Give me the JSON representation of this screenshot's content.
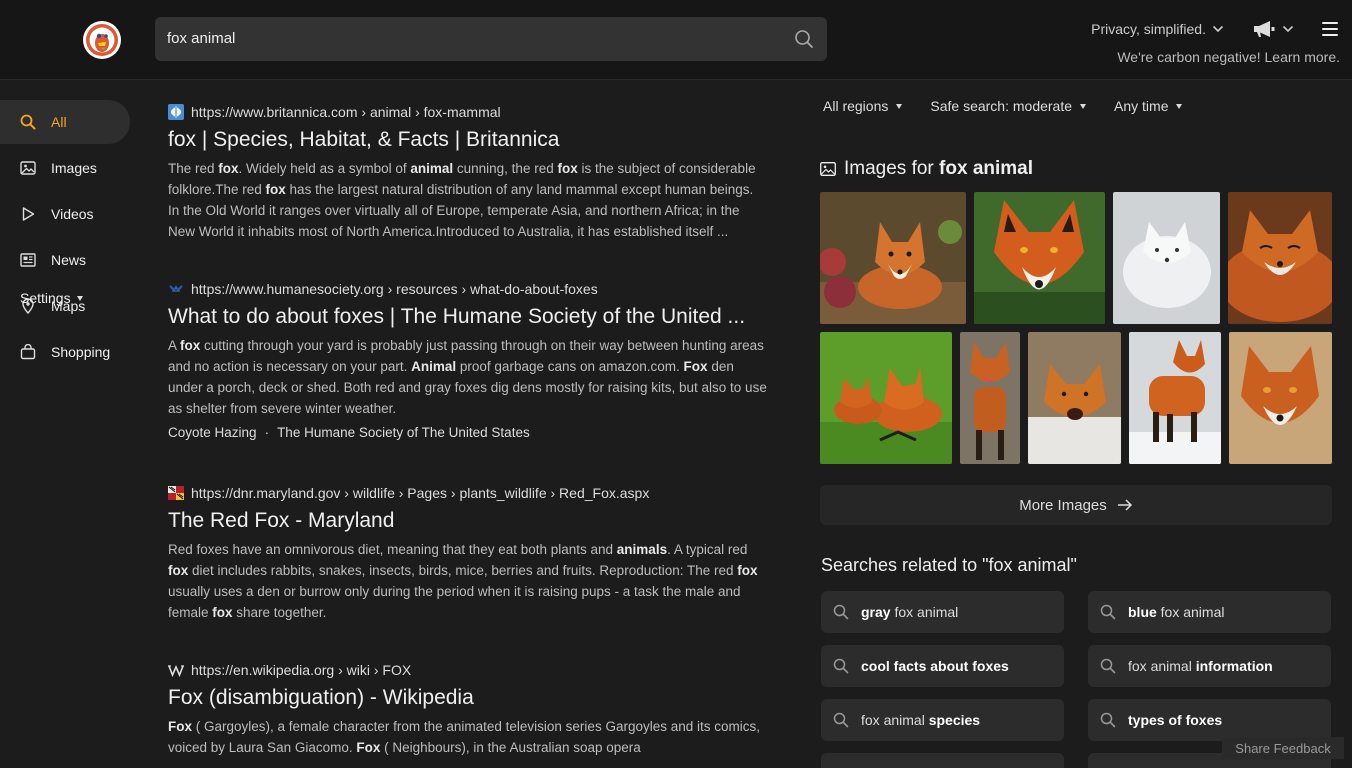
{
  "header": {
    "search_query": "fox animal",
    "privacy_label": "Privacy, simplified.",
    "carbon_text": "We're carbon negative! Learn more."
  },
  "sidebar": {
    "items": [
      {
        "label": "All",
        "icon": "search-icon"
      },
      {
        "label": "Images",
        "icon": "image-icon"
      },
      {
        "label": "Videos",
        "icon": "play-icon"
      },
      {
        "label": "News",
        "icon": "newspaper-icon"
      },
      {
        "label": "Maps",
        "icon": "map-pin-icon"
      },
      {
        "label": "Shopping",
        "icon": "shopping-bag-icon"
      }
    ],
    "settings_label": "Settings"
  },
  "results": [
    {
      "url": "https://www.britannica.com › animal › fox-mammal",
      "title": "fox | Species, Habitat, & Facts | Britannica",
      "snippet": [
        {
          "t": "The red "
        },
        {
          "b": "fox"
        },
        {
          "t": ". Widely held as a symbol of "
        },
        {
          "b": "animal"
        },
        {
          "t": " cunning, the red "
        },
        {
          "b": "fox"
        },
        {
          "t": " is the subject of considerable folklore.The red "
        },
        {
          "b": "fox"
        },
        {
          "t": " has the largest natural distribution of any land mammal except human beings. In the Old World it ranges over virtually all of Europe, temperate Asia, and northern Africa; in the New World it inhabits most of North America.Introduced to Australia, it has established itself ..."
        }
      ]
    },
    {
      "url": "https://www.humanesociety.org › resources › what-do-about-foxes",
      "title": "What to do about foxes | The Humane Society of the United ...",
      "snippet": [
        {
          "t": "A "
        },
        {
          "b": "fox"
        },
        {
          "t": " cutting through your yard is probably just passing through on their way between hunting areas and no action is necessary on your part. "
        },
        {
          "b": "Animal"
        },
        {
          "t": " proof garbage cans on amazon.com. "
        },
        {
          "b": "Fox"
        },
        {
          "t": " den under a porch, deck or shed. Both red and gray foxes dig dens mostly for raising kits, but also to use as shelter from severe winter weather."
        }
      ],
      "sitelinks": [
        "Coyote Hazing",
        "·",
        "The Humane Society of The United States"
      ]
    },
    {
      "url": "https://dnr.maryland.gov › wildlife › Pages › plants_wildlife › Red_Fox.aspx",
      "title": "The Red Fox - Maryland",
      "snippet": [
        {
          "t": "Red foxes have an omnivorous diet, meaning that they eat both plants and "
        },
        {
          "b": "animals"
        },
        {
          "t": ". A typical red "
        },
        {
          "b": "fox"
        },
        {
          "t": " diet includes rabbits, snakes, insects, birds, mice, berries and fruits. Reproduction: The red "
        },
        {
          "b": "fox"
        },
        {
          "t": " usually uses a den or burrow only during the period when it is raising pups - a task the male and female "
        },
        {
          "b": "fox"
        },
        {
          "t": " share together."
        }
      ]
    },
    {
      "url": "https://en.wikipedia.org › wiki › FOX",
      "title": "Fox (disambiguation) - Wikipedia",
      "snippet": [
        {
          "b": "Fox"
        },
        {
          "t": " ( Gargoyles), a female character from the animated television series Gargoyles and its comics, voiced by Laura San Giacomo. "
        },
        {
          "b": "Fox"
        },
        {
          "t": " ( Neighbours), in the Australian soap opera"
        }
      ]
    }
  ],
  "filters": [
    "All regions",
    "Safe search: moderate",
    "Any time"
  ],
  "images": {
    "heading_prefix": "Images for ",
    "heading_query": "fox animal",
    "more_label": "More Images"
  },
  "related": {
    "title": "Searches related to \"fox animal\"",
    "items": [
      [
        {
          "b": "gray"
        },
        {
          "t": " fox animal"
        }
      ],
      [
        {
          "b": "blue"
        },
        {
          "t": " fox animal"
        }
      ],
      [
        {
          "b": "cool facts about foxes"
        }
      ],
      [
        {
          "t": "fox animal "
        },
        {
          "b": "information"
        }
      ],
      [
        {
          "t": "fox animal "
        },
        {
          "b": "species"
        }
      ],
      [
        {
          "b": "types of foxes"
        }
      ]
    ]
  },
  "feedback_label": "Share Feedback",
  "colors": {
    "accent": "#f5a623",
    "background": "#1c1c1c"
  }
}
